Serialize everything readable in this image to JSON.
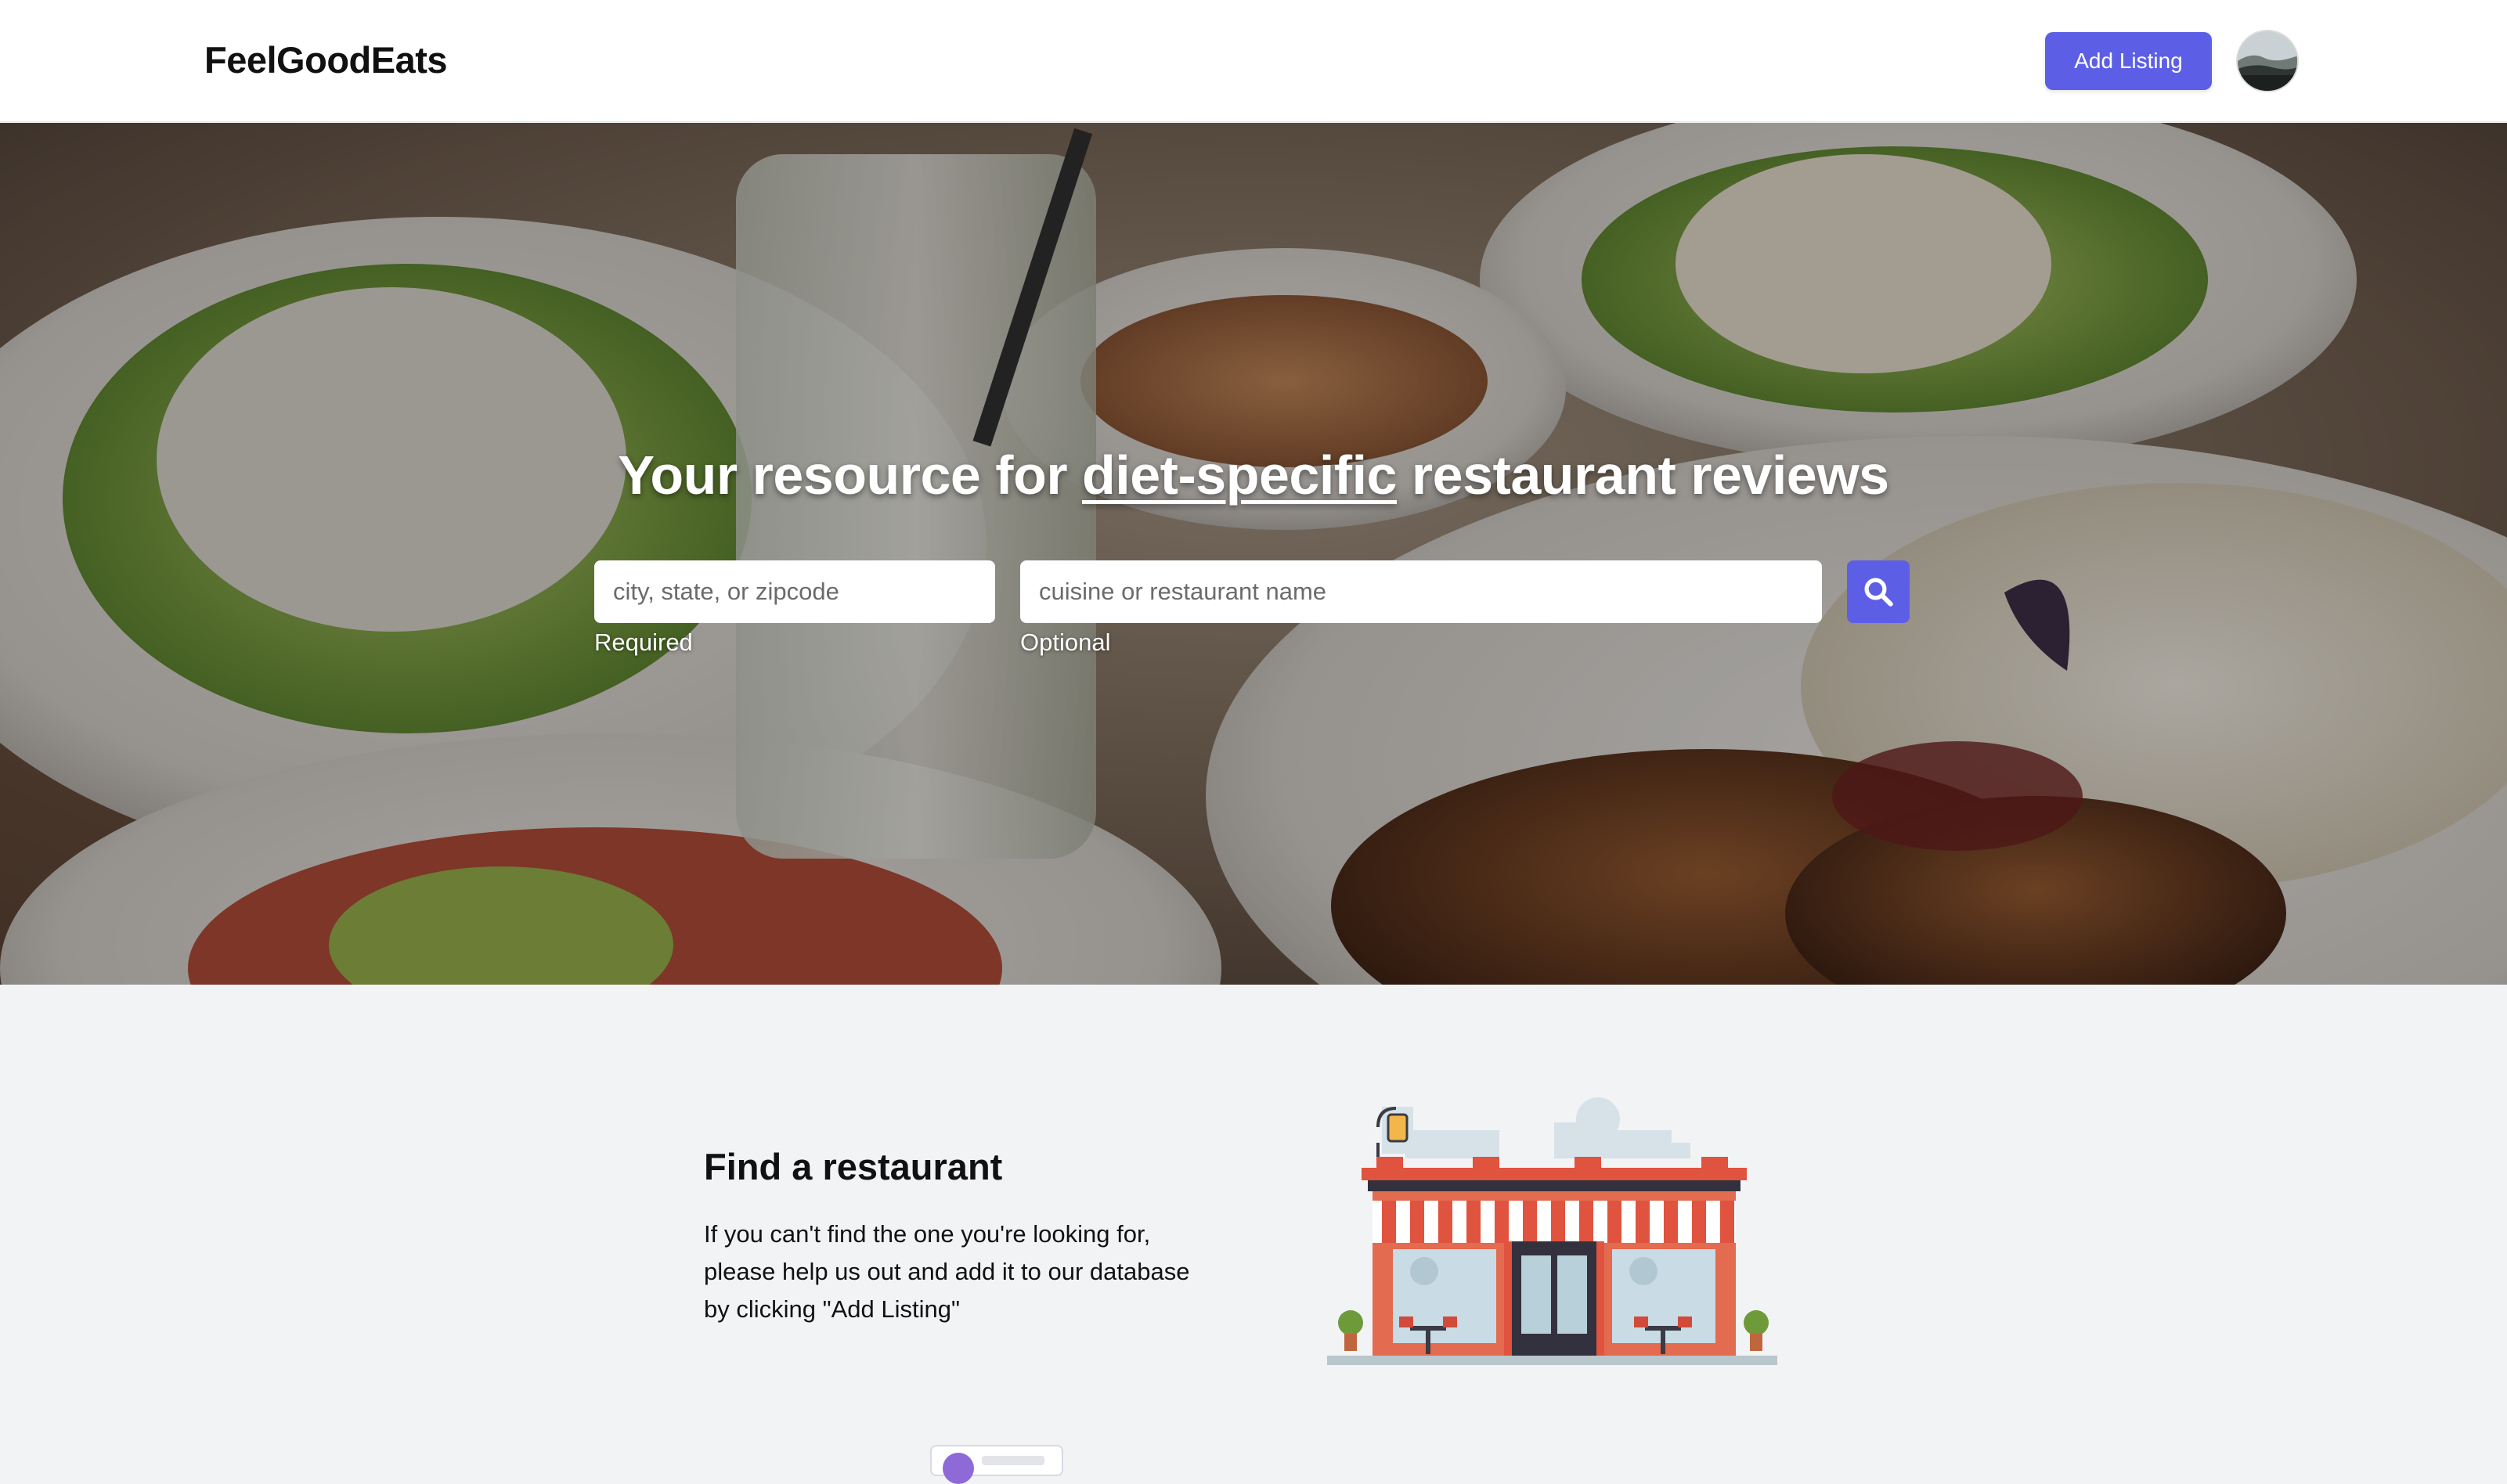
{
  "header": {
    "brand": "FeelGoodEats",
    "add_listing_label": "Add Listing",
    "avatar_icon": "user-avatar"
  },
  "hero": {
    "title_prefix": "Your resource for ",
    "title_highlight": "diet-specific",
    "title_suffix": " restaurant reviews",
    "location": {
      "value": "",
      "placeholder": "city, state, or zipcode",
      "hint": "Required"
    },
    "query": {
      "value": "",
      "placeholder": "cuisine or restaurant name",
      "hint": "Optional"
    },
    "search_icon": "search-icon"
  },
  "find": {
    "title": "Find a restaurant",
    "body": "If you can't find the one you're looking for, please help us out and add it to our database by clicking \"Add Listing\""
  },
  "colors": {
    "accent": "#5c5fe6",
    "header_bg": "#ffffff",
    "section_bg": "#f2f3f5",
    "awning_red": "#e0533f"
  }
}
